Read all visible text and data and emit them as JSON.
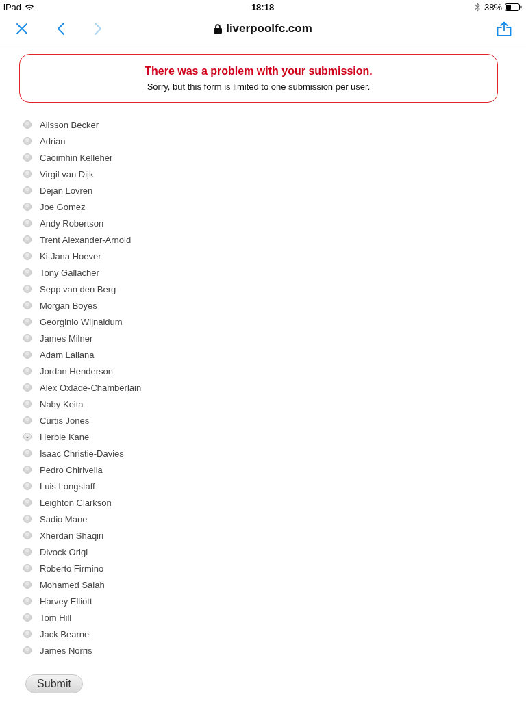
{
  "status_bar": {
    "device": "iPad",
    "time": "18:18",
    "battery": "38%"
  },
  "nav_bar": {
    "left_buttons": [
      {
        "kind": "close",
        "disabled": false
      },
      {
        "kind": "back",
        "disabled": false
      },
      {
        "kind": "forward",
        "disabled": true
      }
    ],
    "domain": "liverpoolfc.com",
    "right_buttons": [
      {
        "kind": "share",
        "disabled": false
      }
    ]
  },
  "error": {
    "title": "There was a problem with your submission.",
    "message": "Sorry, but this form is limited to one submission per user."
  },
  "players": [
    {
      "name": "Alisson Becker",
      "selected": false
    },
    {
      "name": "Adrian",
      "selected": false
    },
    {
      "name": "Caoimhin Kelleher",
      "selected": false
    },
    {
      "name": "Virgil van Dijk",
      "selected": false
    },
    {
      "name": "Dejan Lovren",
      "selected": false
    },
    {
      "name": "Joe Gomez",
      "selected": false
    },
    {
      "name": "Andy Robertson",
      "selected": false
    },
    {
      "name": "Trent Alexander-Arnold",
      "selected": false
    },
    {
      "name": "Ki-Jana Hoever",
      "selected": false
    },
    {
      "name": "Tony Gallacher",
      "selected": false
    },
    {
      "name": "Sepp van den Berg",
      "selected": false
    },
    {
      "name": "Morgan Boyes",
      "selected": false
    },
    {
      "name": "Georginio Wijnaldum",
      "selected": false
    },
    {
      "name": "James Milner",
      "selected": false
    },
    {
      "name": "Adam Lallana",
      "selected": false
    },
    {
      "name": "Jordan Henderson",
      "selected": false
    },
    {
      "name": "Alex Oxlade-Chamberlain",
      "selected": false
    },
    {
      "name": "Naby Keita",
      "selected": false
    },
    {
      "name": "Curtis Jones",
      "selected": false
    },
    {
      "name": "Herbie Kane",
      "selected": true
    },
    {
      "name": "Isaac Christie-Davies",
      "selected": false
    },
    {
      "name": "Pedro Chirivella",
      "selected": false
    },
    {
      "name": "Luis Longstaff",
      "selected": false
    },
    {
      "name": "Leighton Clarkson",
      "selected": false
    },
    {
      "name": "Sadio Mane",
      "selected": false
    },
    {
      "name": "Xherdan Shaqiri",
      "selected": false
    },
    {
      "name": "Divock Origi",
      "selected": false
    },
    {
      "name": "Roberto Firmino",
      "selected": false
    },
    {
      "name": "Mohamed Salah",
      "selected": false
    },
    {
      "name": "Harvey Elliott",
      "selected": false
    },
    {
      "name": "Tom Hill",
      "selected": false
    },
    {
      "name": "Jack Bearne",
      "selected": false
    },
    {
      "name": "James Norris",
      "selected": false
    }
  ],
  "submit": {
    "label": "Submit"
  }
}
